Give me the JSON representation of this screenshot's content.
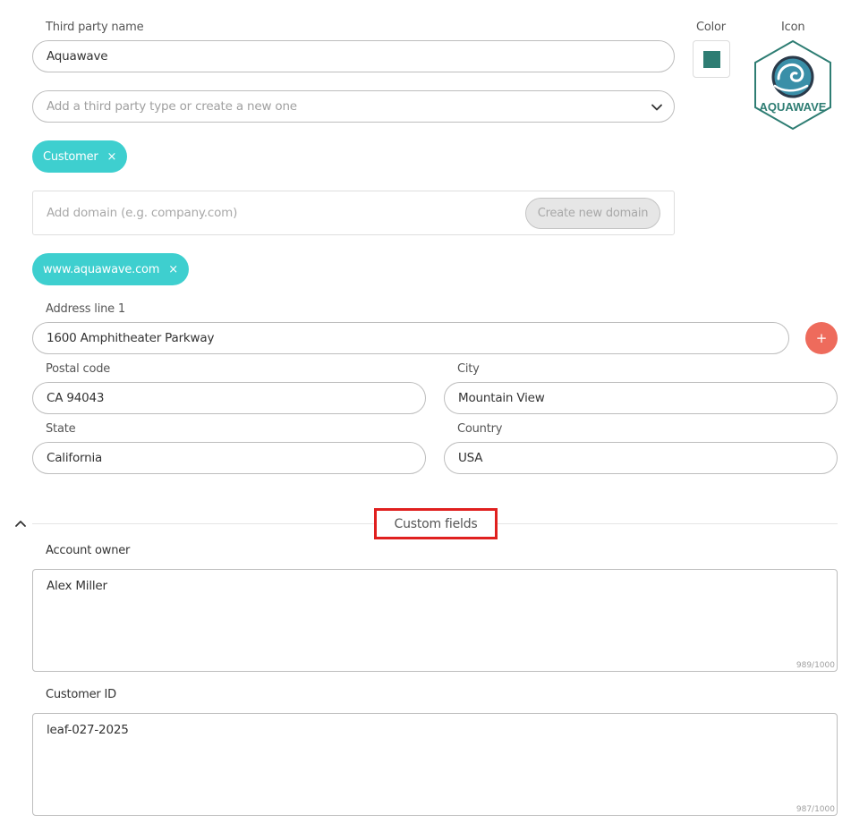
{
  "form": {
    "third_party_name": {
      "label": "Third party name",
      "value": "Aquawave"
    },
    "color": {
      "label": "Color",
      "value": "#2e7d73"
    },
    "icon": {
      "label": "Icon",
      "logo_text": "AQUAWAVE",
      "icon_name": "aquawave-logo-icon"
    },
    "type_select": {
      "placeholder": "Add a third party type or create a new one"
    },
    "type_chips": [
      {
        "label": "Customer",
        "remove": "×"
      }
    ],
    "domain": {
      "placeholder": "Add domain (e.g. company.com)",
      "create_button": "Create new domain"
    },
    "domain_chips": [
      {
        "label": "www.aquawave.com",
        "remove": "×"
      }
    ],
    "address_line_1": {
      "label": "Address line 1",
      "value": "1600 Amphitheater Parkway",
      "add_button": "+"
    },
    "postal_code": {
      "label": "Postal code",
      "value": "CA 94043"
    },
    "city": {
      "label": "City",
      "value": "Mountain View"
    },
    "state": {
      "label": "State",
      "value": "California"
    },
    "country": {
      "label": "Country",
      "value": "USA"
    }
  },
  "custom_fields": {
    "section_title": "Custom fields",
    "fields": [
      {
        "label": "Account owner",
        "value": "Alex Miller",
        "counter": "989/1000"
      },
      {
        "label": "Customer ID",
        "value": "leaf-027-2025",
        "counter": "987/1000"
      }
    ]
  },
  "colors": {
    "chip": "#3ecfcf",
    "add_button": "#ee6b5c",
    "highlight": "#e0201f",
    "logo": "#2e7d73"
  }
}
